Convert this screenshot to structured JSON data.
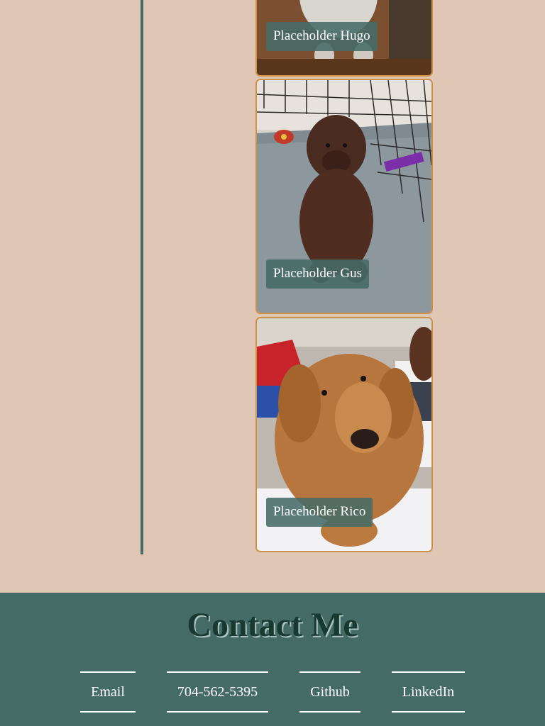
{
  "gallery": {
    "items": [
      {
        "caption": "Placeholder Hugo",
        "photo": "dog-photo"
      },
      {
        "caption": "Placeholder Gus",
        "photo": "dog-photo"
      },
      {
        "caption": "Placeholder Rico",
        "photo": "dog-photo"
      }
    ]
  },
  "contact": {
    "title": "Contact Me",
    "links": {
      "email": "Email",
      "phone": "704-562-5395",
      "github": "Github",
      "linkedin": "LinkedIn"
    }
  },
  "colors": {
    "background": "#dfc6b5",
    "accent": "#456b66",
    "card_border": "#cf9247",
    "title_text": "#17392f"
  }
}
